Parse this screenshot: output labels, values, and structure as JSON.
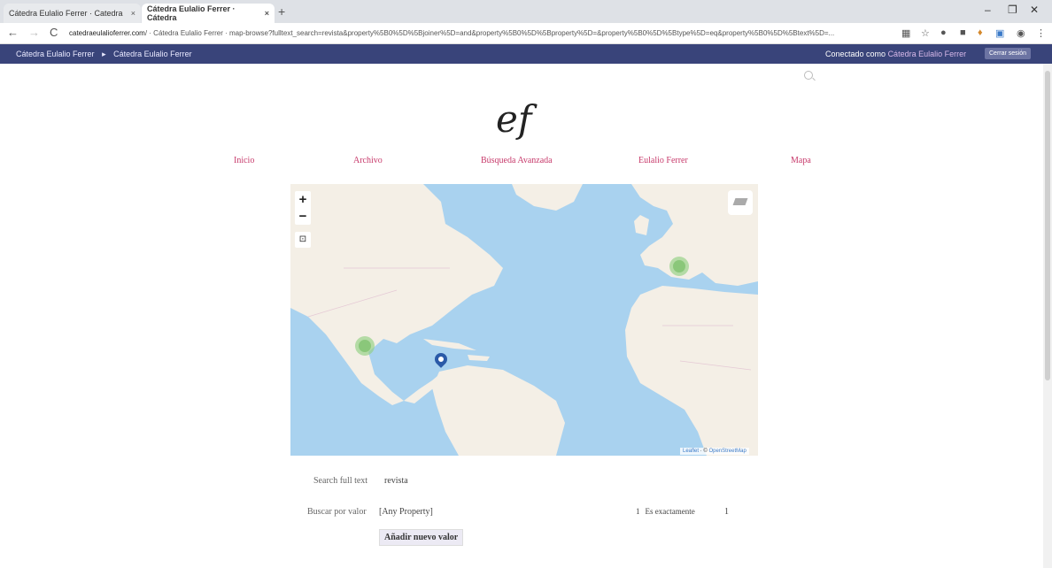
{
  "browser": {
    "tabs": [
      {
        "title": "Cátedra Eulalio Ferrer · Catedra",
        "close": "×"
      },
      {
        "title": "Cátedra Eulalio Ferrer · Cátedra",
        "close": "×"
      }
    ],
    "new_tab": "+",
    "url_host": "catedraeulalioferrer.com",
    "url_rest": "/ · Cátedra Eulalio Ferrer · map-browse?fulltext_search=revista&property%5B0%5D%5Bjoiner%5D=and&property%5B0%5D%5Bproperty%5D=&property%5B0%5D%5Btype%5D=eq&property%5B0%5D%5Btext%5D=...",
    "back": "←",
    "forward": "→",
    "reload": "C",
    "minimize": "–",
    "maximize": "❐",
    "close": "✕"
  },
  "sitebar": {
    "crumb_home": "Cátedra Eulalio Ferrer",
    "crumb_separator": "▸",
    "crumb_site": "Cátedra Eulalio Ferrer",
    "logged_in_prefix": "Conectado como",
    "logged_in_user": "Cátedra Eulalio Ferrer",
    "logout": "Cerrar sesión"
  },
  "logo": "ef",
  "menu": [
    "Inicio",
    "Archivo",
    "Búsqueda Avanzada",
    "Eulalio Ferrer",
    "Mapa"
  ],
  "map": {
    "zoom_in": "+",
    "zoom_out": "−",
    "fullscreen": "⊡",
    "attribution_leaflet": "Leaflet",
    "attribution_sep": " · © ",
    "attribution_osm": "OpenStreetMap"
  },
  "form": {
    "search_label": "Search full text",
    "search_value": "revista",
    "filter_label": "Buscar por valor",
    "filter_property": "[Any Property]",
    "filter_type": "Es exactamente",
    "filter_count": "1",
    "add_value": "Añadir nuevo valor"
  },
  "colors": {
    "accent": "#c73a6b",
    "header": "#39447a",
    "water": "#a9d2ef",
    "cluster": "#8ac77a",
    "pin": "#2a5aa8"
  }
}
